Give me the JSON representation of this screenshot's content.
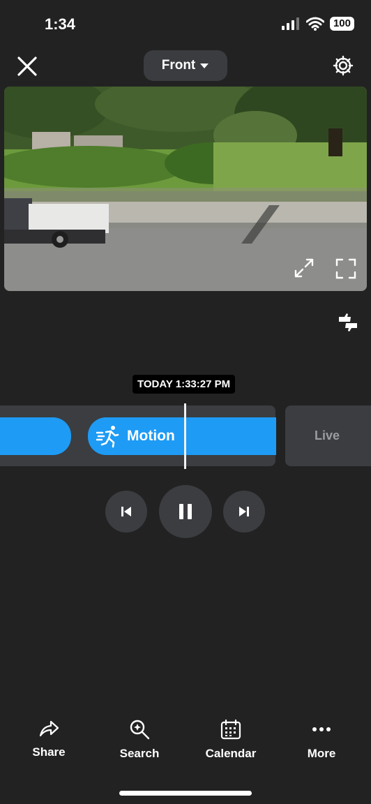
{
  "status_bar": {
    "time": "1:34",
    "battery": "100"
  },
  "header": {
    "camera_name": "Front",
    "icons": [
      "close-icon",
      "chevron-down-icon",
      "gear-icon"
    ]
  },
  "video": {
    "icons": [
      "expand-icon",
      "fullscreen-icon",
      "thumbs-feedback-icon"
    ]
  },
  "timeline": {
    "timestamp": "TODAY 1:33:27 PM",
    "event_label": "Motion",
    "live_label": "Live",
    "accent_color": "#1e9bf5"
  },
  "playback": {
    "icons": [
      "skip-previous-icon",
      "pause-icon",
      "skip-next-icon"
    ]
  },
  "bottom_nav": {
    "items": [
      {
        "label": "Share",
        "icon": "share-icon"
      },
      {
        "label": "Search",
        "icon": "search-icon"
      },
      {
        "label": "Calendar",
        "icon": "calendar-icon"
      },
      {
        "label": "More",
        "icon": "more-icon"
      }
    ]
  }
}
